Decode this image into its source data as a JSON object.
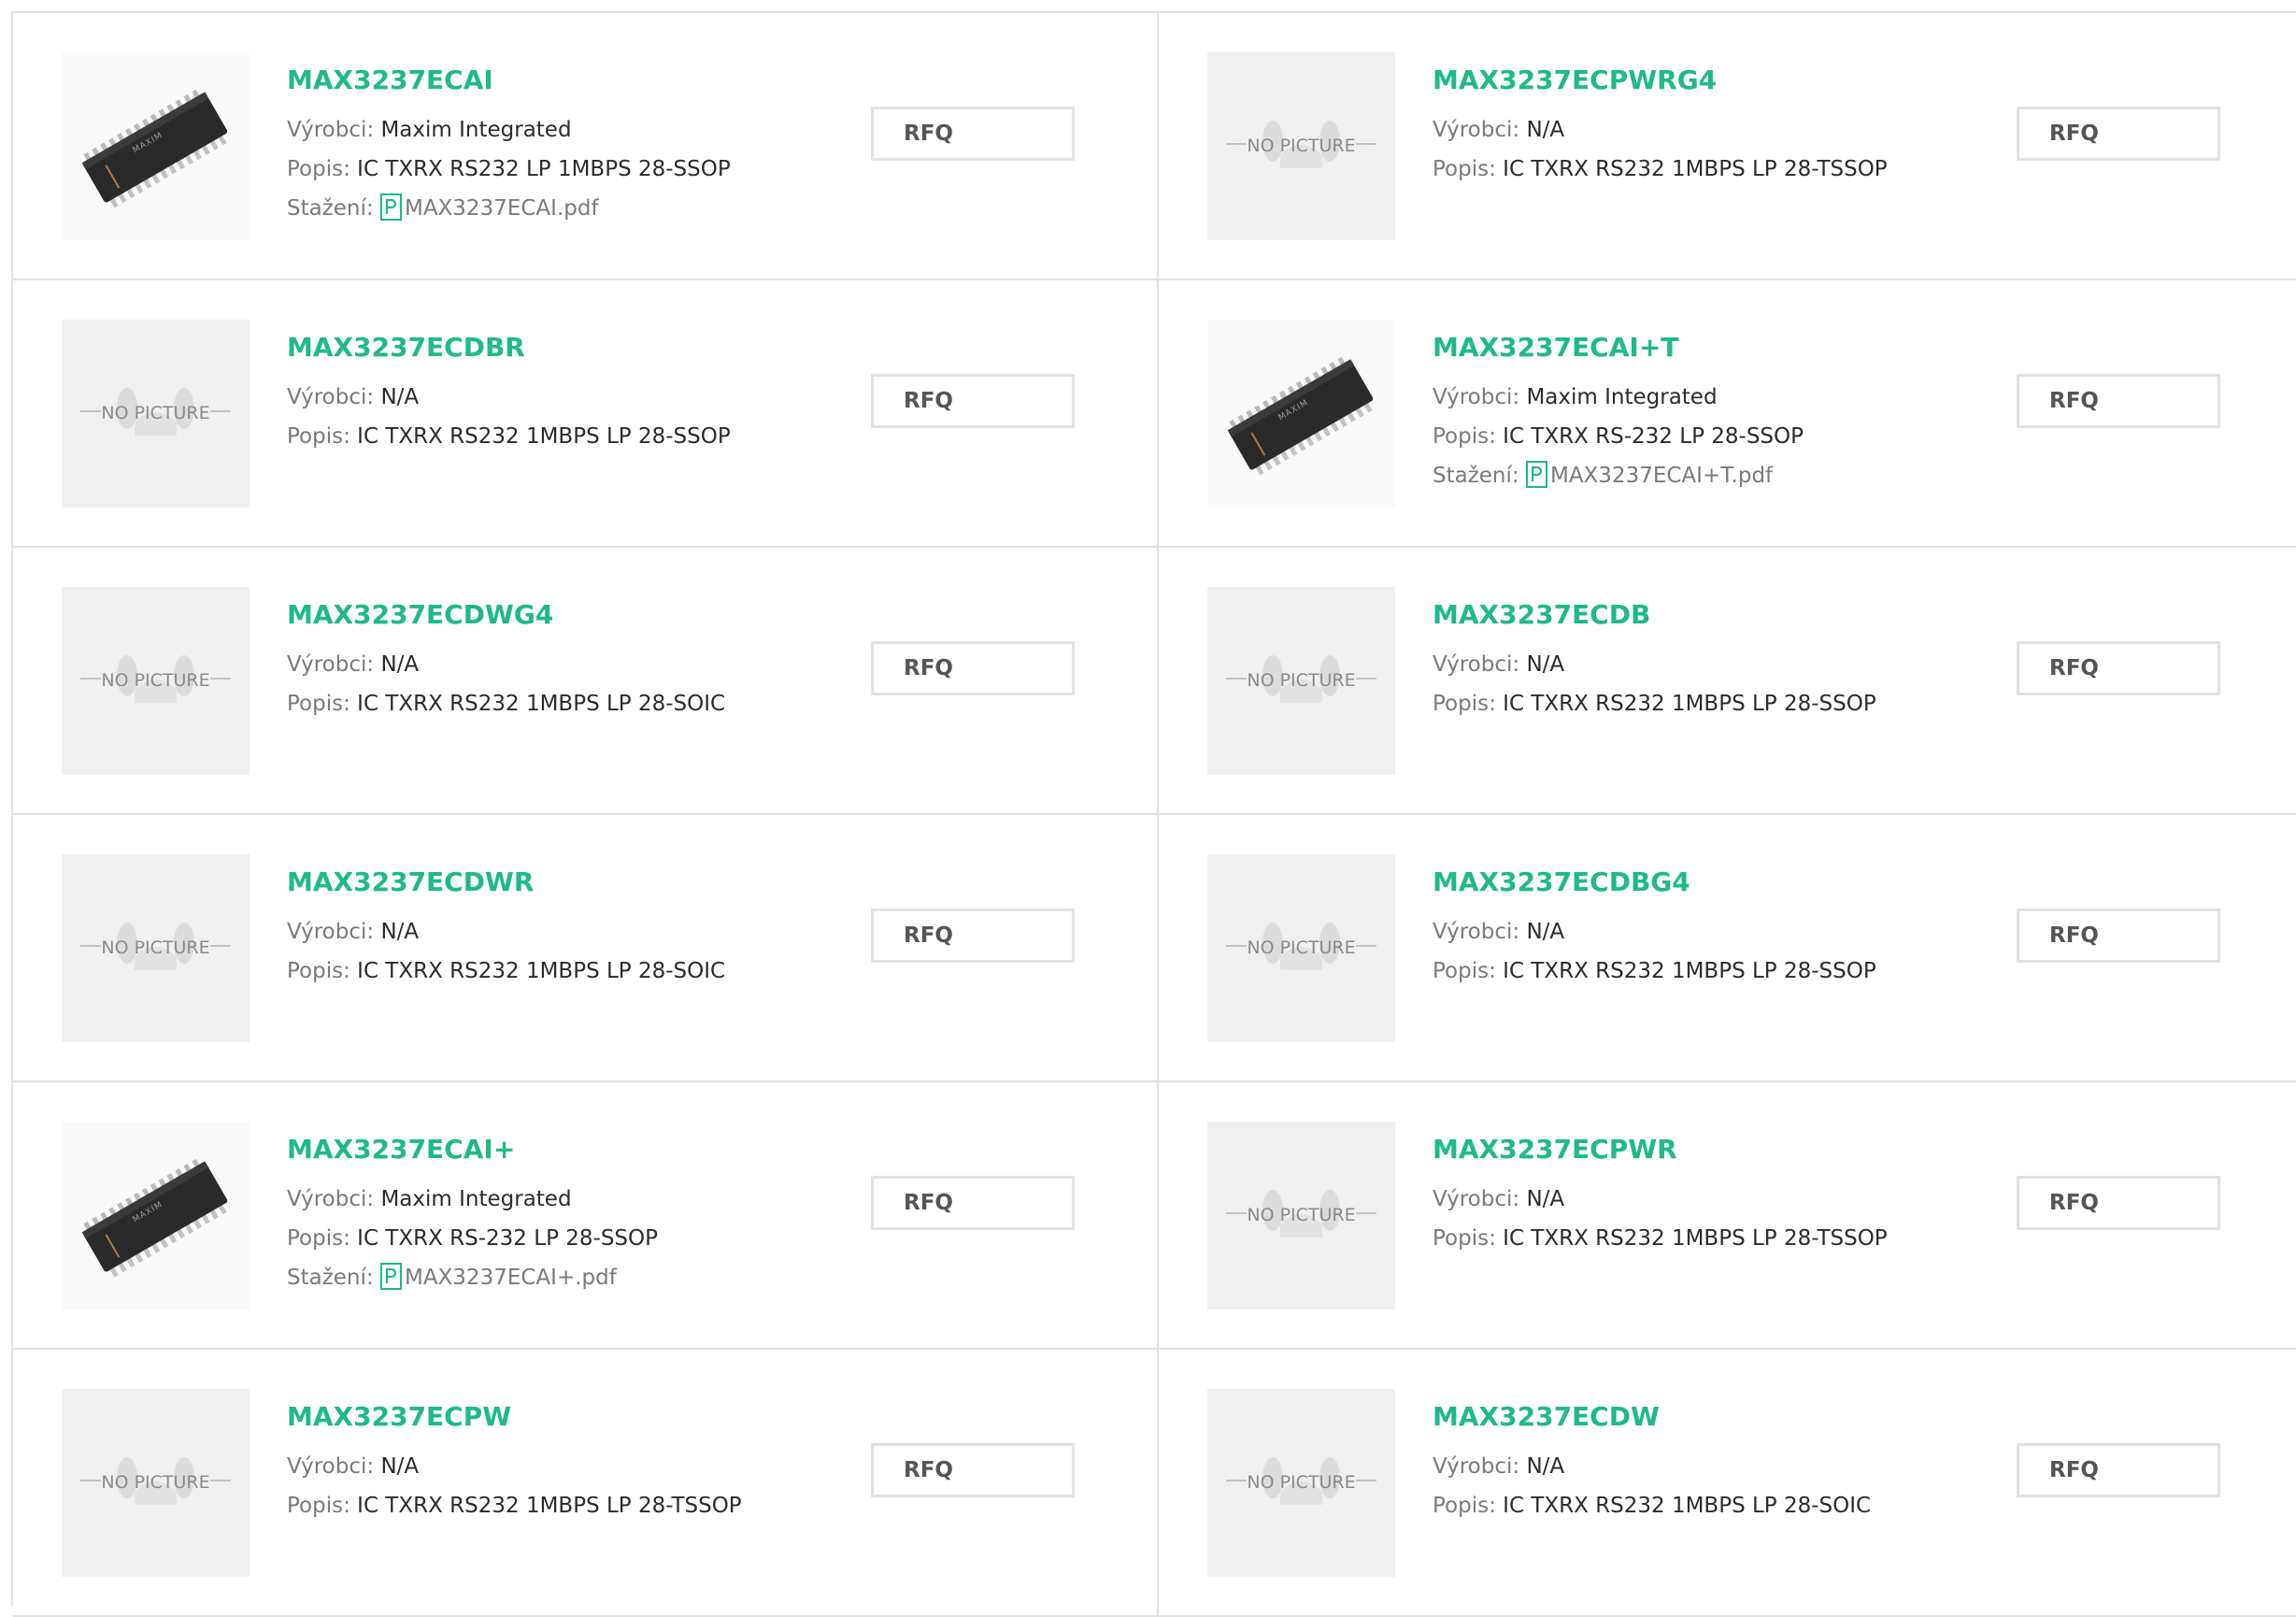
{
  "labels": {
    "manufacturer": "Výrobci:",
    "description": "Popis:",
    "download": "Stažení:",
    "rfq": "RFQ",
    "no_picture": "NO PICTURE",
    "chip_logo": "MAXIM"
  },
  "colors": {
    "part_link": "#1fb98b",
    "label": "#7a7a7a",
    "border": "#e2e2e2",
    "placeholder_bg": "#f0f0f0"
  },
  "products": [
    {
      "part": "MAX3237ECAI",
      "manufacturer": "Maxim Integrated",
      "description": "IC TXRX RS232 LP 1MBPS 28-SSOP",
      "download": "MAX3237ECAI.pdf",
      "image": "chip-photo"
    },
    {
      "part": "MAX3237ECPWRG4",
      "manufacturer": "N/A",
      "description": "IC TXRX RS232 1MBPS LP 28-TSSOP",
      "download": null,
      "image": "no-picture"
    },
    {
      "part": "MAX3237ECDBR",
      "manufacturer": "N/A",
      "description": "IC TXRX RS232 1MBPS LP 28-SSOP",
      "download": null,
      "image": "no-picture"
    },
    {
      "part": "MAX3237ECAI+T",
      "manufacturer": "Maxim Integrated",
      "description": "IC TXRX RS-232 LP 28-SSOP",
      "download": "MAX3237ECAI+T.pdf",
      "image": "chip-photo"
    },
    {
      "part": "MAX3237ECDWG4",
      "manufacturer": "N/A",
      "description": "IC TXRX RS232 1MBPS LP 28-SOIC",
      "download": null,
      "image": "no-picture"
    },
    {
      "part": "MAX3237ECDB",
      "manufacturer": "N/A",
      "description": "IC TXRX RS232 1MBPS LP 28-SSOP",
      "download": null,
      "image": "no-picture"
    },
    {
      "part": "MAX3237ECDWR",
      "manufacturer": "N/A",
      "description": "IC TXRX RS232 1MBPS LP 28-SOIC",
      "download": null,
      "image": "no-picture"
    },
    {
      "part": "MAX3237ECDBG4",
      "manufacturer": "N/A",
      "description": "IC TXRX RS232 1MBPS LP 28-SSOP",
      "download": null,
      "image": "no-picture"
    },
    {
      "part": "MAX3237ECAI+",
      "manufacturer": "Maxim Integrated",
      "description": "IC TXRX RS-232 LP 28-SSOP",
      "download": "MAX3237ECAI+.pdf",
      "image": "chip-photo"
    },
    {
      "part": "MAX3237ECPWR",
      "manufacturer": "N/A",
      "description": "IC TXRX RS232 1MBPS LP 28-TSSOP",
      "download": null,
      "image": "no-picture"
    },
    {
      "part": "MAX3237ECPW",
      "manufacturer": "N/A",
      "description": "IC TXRX RS232 1MBPS LP 28-TSSOP",
      "download": null,
      "image": "no-picture"
    },
    {
      "part": "MAX3237ECDW",
      "manufacturer": "N/A",
      "description": "IC TXRX RS232 1MBPS LP 28-SOIC",
      "download": null,
      "image": "no-picture"
    }
  ]
}
